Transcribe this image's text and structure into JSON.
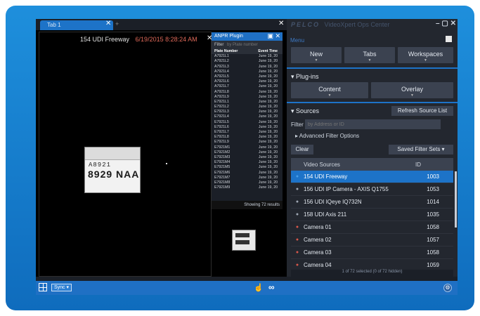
{
  "tabs": [
    {
      "label": "Tab 1"
    },
    {
      "label": "+"
    }
  ],
  "video": {
    "camera_name": "154 UDI Freeway",
    "timestamp": "6/19/2015 8:28:24 AM",
    "plate_line1": "A8921",
    "plate_line2": "8929 NAA"
  },
  "lpr": {
    "title": "ANPR Plugin",
    "filter_label": "Filter",
    "filter_placeholder": "by Plate number",
    "col_plate": "Plate Number",
    "col_time": "Event Time",
    "rows": [
      {
        "plate": "A7921L1",
        "time": "June 19, 20"
      },
      {
        "plate": "A7921L2",
        "time": "June 19, 20"
      },
      {
        "plate": "A7921L3",
        "time": "June 19, 20"
      },
      {
        "plate": "A7921L4",
        "time": "June 19, 20"
      },
      {
        "plate": "A7921L5",
        "time": "June 19, 20"
      },
      {
        "plate": "A7921L6",
        "time": "June 19, 20"
      },
      {
        "plate": "A7921L7",
        "time": "June 19, 20"
      },
      {
        "plate": "A7921L8",
        "time": "June 19, 20"
      },
      {
        "plate": "A7921L9",
        "time": "June 19, 20"
      },
      {
        "plate": "E7921L1",
        "time": "June 19, 20"
      },
      {
        "plate": "E7921L2",
        "time": "June 19, 20"
      },
      {
        "plate": "E7921L3",
        "time": "June 19, 20"
      },
      {
        "plate": "E7921L4",
        "time": "June 19, 20"
      },
      {
        "plate": "E7921L5",
        "time": "June 19, 20"
      },
      {
        "plate": "E7921L6",
        "time": "June 19, 20"
      },
      {
        "plate": "E7921L7",
        "time": "June 19, 20"
      },
      {
        "plate": "E7921L8",
        "time": "June 19, 20"
      },
      {
        "plate": "E7921L9",
        "time": "June 19, 20"
      },
      {
        "plate": "E7921M1",
        "time": "June 19, 20"
      },
      {
        "plate": "E7921M2",
        "time": "June 19, 20"
      },
      {
        "plate": "E7921M3",
        "time": "June 19, 20"
      },
      {
        "plate": "E7921M4",
        "time": "June 19, 20"
      },
      {
        "plate": "E7921M5",
        "time": "June 19, 20"
      },
      {
        "plate": "E7921M6",
        "time": "June 19, 20"
      },
      {
        "plate": "E7921M7",
        "time": "June 19, 20"
      },
      {
        "plate": "E7921M8",
        "time": "June 19, 20"
      },
      {
        "plate": "E7921M9",
        "time": "June 19, 20"
      }
    ],
    "footer": "Showing 72 results"
  },
  "right_panel": {
    "brand": "PELCO",
    "brand_sub": "VideoXpert Ops Center",
    "menu_label": "Menu",
    "buttons_top": [
      {
        "label": "New"
      },
      {
        "label": "Tabs"
      },
      {
        "label": "Workspaces"
      }
    ],
    "plugins_heading": "Plug-ins",
    "buttons_plugins": [
      {
        "label": "Content"
      },
      {
        "label": "Overlay"
      }
    ],
    "sources_heading": "Sources",
    "refresh_label": "Refresh Source List",
    "filter_label": "Filter",
    "filter_placeholder": "by Address or ID",
    "advanced_label": "Advanced Filter Options",
    "clear_label": "Clear",
    "saved_label": "Saved Filter Sets",
    "col_name": "Video Sources",
    "col_id": "ID",
    "sources": [
      {
        "name": "154 UDI Freeway",
        "id": "1003",
        "status": "blue",
        "selected": true
      },
      {
        "name": "156 UDI IP Camera - AXIS Q1755",
        "id": "1053",
        "status": "gray",
        "selected": false
      },
      {
        "name": "156 UDI IQeye IQ732N",
        "id": "1014",
        "status": "gray",
        "selected": false
      },
      {
        "name": "158 UDI Axis 211",
        "id": "1035",
        "status": "gray",
        "selected": false
      },
      {
        "name": "Camera 01",
        "id": "1058",
        "status": "red",
        "selected": false
      },
      {
        "name": "Camera 02",
        "id": "1057",
        "status": "red",
        "selected": false
      },
      {
        "name": "Camera 03",
        "id": "1058",
        "status": "red",
        "selected": false
      },
      {
        "name": "Camera 04",
        "id": "1059",
        "status": "red",
        "selected": false
      }
    ],
    "count_text": "1 of 72 selected (0 of 72 hidden)"
  },
  "bottom_bar": {
    "sync_label": "Sync"
  },
  "colors": {
    "frame": "#1a82d6",
    "accent": "#1d73c8",
    "panel": "#23272f",
    "button": "#3b4250"
  }
}
